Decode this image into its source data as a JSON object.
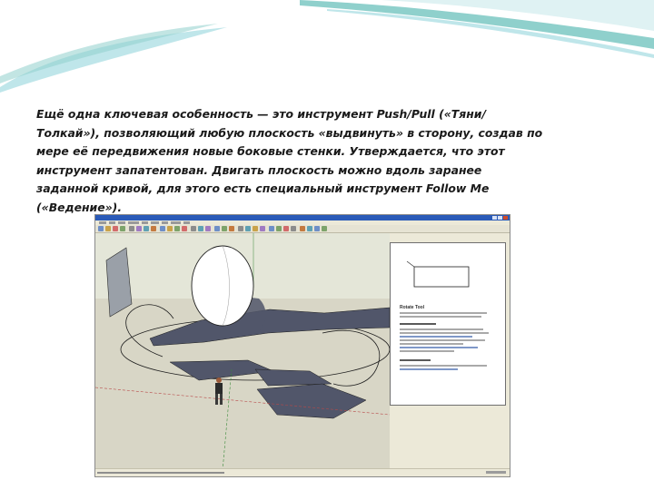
{
  "slide": {
    "paragraph": "Ещё одна ключевая особенность — это инструмент Push/Pull («Тяни/Толкай»), позволяющий любую плоскость «выдвинуть» в сторону, создав по мере её передвижения новые боковые стенки. Утверждается, что этот инструмент запатентован. Двигать плоскость можно вдоль заранее заданной кривой, для этого есть специальный инструмент Follow Me («Ведение»)."
  },
  "screenshot": {
    "panel_title": "Rotate Tool"
  },
  "colors": {
    "accent_teal": "#8fd0cc",
    "accent_blue": "#bfe6ea",
    "canvas_bg": "#d8d6c6",
    "sky": "#e4e6d8",
    "face": "#51566a",
    "titlebar": "#2a5ab8"
  }
}
